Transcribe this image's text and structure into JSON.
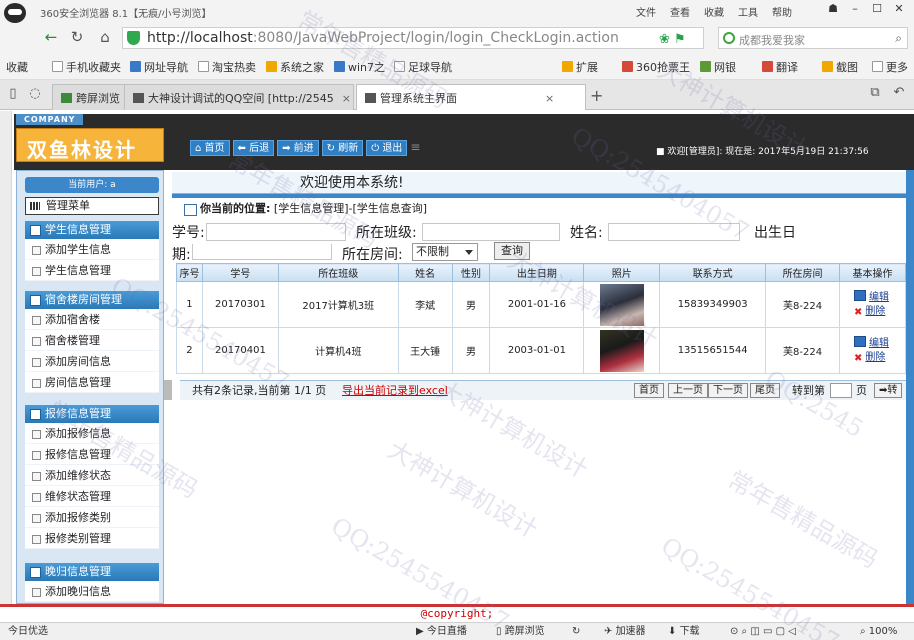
{
  "browser": {
    "title": "360安全浏览器 8.1【无痕/小号浏览】",
    "menu": [
      "文件",
      "查看",
      "收藏",
      "工具",
      "帮助"
    ],
    "url_host": "http://localhost",
    "url_rest": ":8080/JavaWebProject/login/login_CheckLogin.action",
    "search_placeholder": "成都我爱我家",
    "bookmarks": [
      "收藏",
      "手机收藏夹",
      "网址导航",
      "淘宝热卖",
      "系统之家",
      "win7之",
      "足球导航",
      "扩展",
      "360抢票王",
      "网银",
      "翻译",
      "截图",
      "更多"
    ],
    "tabs": [
      {
        "label": "跨屏浏览",
        "close": ""
      },
      {
        "label": "大神设计调试的QQ空间 [http://2545",
        "close": "×"
      },
      {
        "label": "管理系统主界面",
        "close": "×"
      }
    ]
  },
  "header": {
    "company": "COMPANY",
    "logo": "双鱼林设计",
    "buttons": [
      "首页",
      "后退",
      "前进",
      "刷新",
      "退出"
    ],
    "status": "欢迎[管理员]:   现在是: 2017年5月19日 21:37:56"
  },
  "sidebar": {
    "current_user": "当前用户: a",
    "system_menu": "管理菜单",
    "groups": [
      {
        "title": "学生信息管理",
        "items": [
          "添加学生信息",
          "学生信息管理"
        ]
      },
      {
        "title": "宿舍楼房间管理",
        "items": [
          "添加宿舍楼",
          "宿舍楼管理",
          "添加房间信息",
          "房间信息管理"
        ]
      },
      {
        "title": "报修信息管理",
        "items": [
          "添加报修信息",
          "报修信息管理",
          "添加维修状态",
          "维修状态管理",
          "添加报修类别",
          "报修类别管理"
        ]
      },
      {
        "title": "晚归信息管理",
        "items": [
          "添加晚归信息"
        ]
      }
    ]
  },
  "main": {
    "welcome": "欢迎使用本系统!",
    "crumb_label": "你当前的位置:",
    "crumb_path": "[学生信息管理]-[学生信息查询]",
    "filter": {
      "student_no_label": "学号:",
      "class_label": "所在班级:",
      "name_label": "姓名:",
      "birth_label_a": "出生日",
      "birth_label_b": "期:",
      "room_label": "所在房间:",
      "room_value": "不限制",
      "query_button": "查询"
    },
    "table": {
      "headers": [
        "序号",
        "学号",
        "所在班级",
        "姓名",
        "性别",
        "出生日期",
        "照片",
        "联系方式",
        "所在房间",
        "基本操作"
      ],
      "rows": [
        [
          "1",
          "20170301",
          "2017计算机3班",
          "李斌",
          "男",
          "2001-01-16",
          "",
          "15839349903",
          "芙8-224"
        ],
        [
          "2",
          "20170401",
          "计算机4班",
          "王大锤",
          "男",
          "2003-01-01",
          "",
          "13515651544",
          "芙8-224"
        ]
      ],
      "edit_label": "编辑",
      "delete_label": "删除"
    },
    "pager": {
      "summary": "共有2条记录,当前第 1/1 页",
      "export": "导出当前记录到excel",
      "first": "首页",
      "prev": "上一页",
      "next": "下一页",
      "last": "尾页",
      "goto_label": "转到第",
      "page_label": "页",
      "go": "➡转"
    },
    "copyright": "@copyright;"
  },
  "statusbar": {
    "items": [
      "今日优选",
      "今日直播",
      "跨屏浏览",
      "加速器",
      "下载",
      "100%"
    ]
  },
  "watermarks": [
    "常年售精品源码",
    "大神计算机设计",
    "QQ:2545404057",
    "大神计算机设计",
    "QQ:2545540457",
    "常年售精品源码",
    "大神计算机设计",
    "QQ:2545540457",
    "常年售精品源码",
    "QQ:2545540457",
    "常年售精品源码",
    "大神计算机设计",
    "QQ:2545"
  ]
}
